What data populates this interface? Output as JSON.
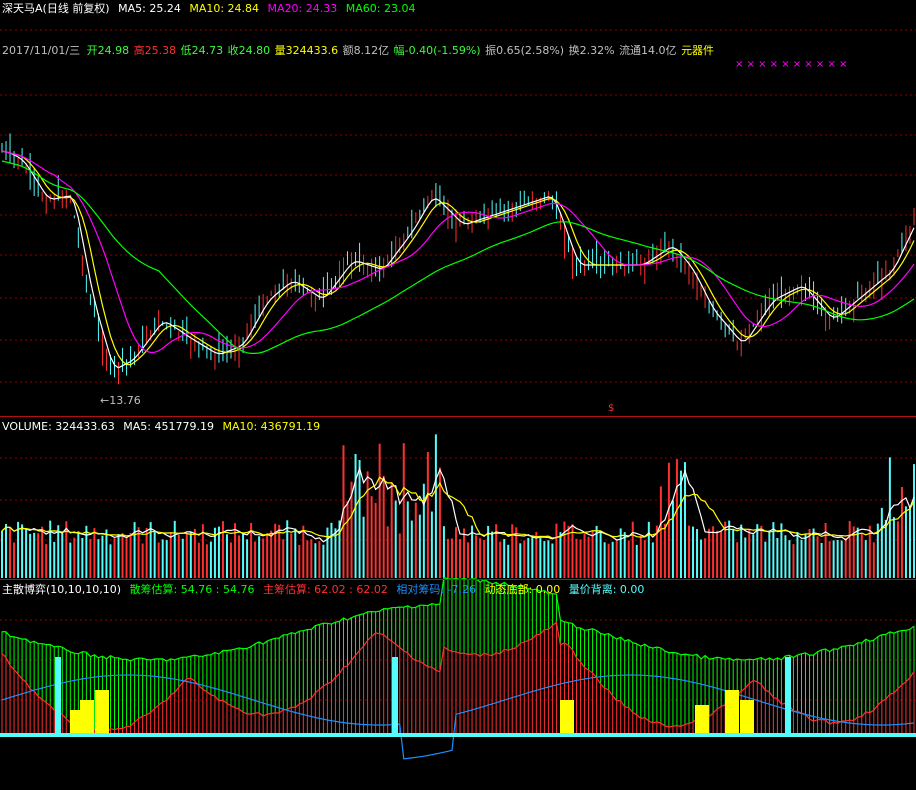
{
  "header": {
    "title": "深天马A(日线 前复权)",
    "ma5": "MA5: 25.24",
    "ma10": "MA10: 24.84",
    "ma20": "MA20: 24.33",
    "ma60": "MA60: 23.04"
  },
  "info_bar": {
    "date": "2017/11/01/三",
    "open": "开24.98",
    "high": "高25.38",
    "low": "低24.73",
    "close": "收24.80",
    "volume": "量324433.6",
    "amount": "额8.12亿",
    "change": "幅-0.40(-1.59%)",
    "amplitude": "振0.65(2.58%)",
    "turnover": "换2.32%",
    "float": "流通14.0亿",
    "sector": "元器件"
  },
  "price_panel": {
    "low_label": "13.76",
    "marker": "$",
    "x_marks": "× ×  ×   × ×  ×  ×      ×   × ×"
  },
  "volume_panel": {
    "label": "VOLUME: 324433.63",
    "ma5": "MA5: 451779.19",
    "ma10": "MA10: 436791.19"
  },
  "indicator_panel": {
    "name": "主散博弈(10,10,10,10)",
    "retail": "散筹估算: 54.76 : 54.76",
    "main": "主筹估算: 62.02 : 62.02",
    "relative": "相对筹码: -7.26",
    "bottom": "动态底部: 0.00",
    "divergence": "量价背离: 0.00"
  },
  "colors": {
    "up": "#ff3030",
    "down": "#54fcfc",
    "white": "#ffffff",
    "yellow": "#ffff00",
    "magenta": "#ff00ff",
    "green": "#00ff00",
    "blue": "#1e90ff",
    "grid": "#8b0000"
  },
  "chart_data": {
    "type": "candlestick",
    "title": "深天马A(日线 前复权)",
    "date": "2017/11/01",
    "ohlc_last": {
      "open": 24.98,
      "high": 25.38,
      "low": 24.73,
      "close": 24.8
    },
    "volume_last": 324433.63,
    "ma": {
      "MA5": 25.24,
      "MA10": 24.84,
      "MA20": 24.33,
      "MA60": 23.04
    },
    "volume_ma": {
      "MA5": 451779.19,
      "MA10": 436791.19
    },
    "period_low": 13.76,
    "indicator": {
      "name": "主散博弈(10,10,10,10)",
      "散筹估算": 54.76,
      "主筹估算": 62.02,
      "相对筹码": -7.26,
      "动态底部": 0.0,
      "量价背离": 0.0
    }
  }
}
